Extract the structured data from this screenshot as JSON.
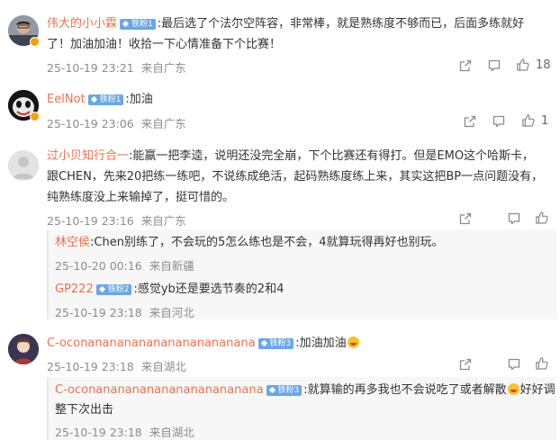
{
  "comments": [
    {
      "username": "伟大的小小霖",
      "badge": "铁粉1",
      "line1": ":最后选了个法尔空阵容，非常棒，就是熟练度不够而已，后面多练就好",
      "line2": "了！加油加油！收拾一下心情准备下个比赛！",
      "time": "25-10-19 23:21",
      "location": "来自广东",
      "likes": "18"
    },
    {
      "username": "EelNot",
      "badge": "铁粉1",
      "line1": ":加油",
      "time": "25-10-19 23:06",
      "location": "来自广东",
      "likes": "1"
    },
    {
      "username": "过小贝知行合一",
      "line1": ":能赢一把李逵，说明还没完全崩，下个比赛还有得打。但是EMO这个哈斯卡，",
      "line2": "跟CHEN，先来20把练一练吧，不说练成绝活，起码熟练度练上来，其实这把BP一点问题没有，",
      "line3": "纯熟练度没上来输掉了，挺可惜的。",
      "time": "25-10-19 23:16",
      "location": "来自广东",
      "likes": "",
      "replies": [
        {
          "username": "林空侯",
          "text": ":Chen别练了，不会玩的5怎么练也是不会，4就算玩得再好也别玩。",
          "time": "25-10-20 00:16",
          "location": "来自新疆"
        },
        {
          "username": "GP222",
          "badge": "铁粉2",
          "text": ":感觉yb还是要选节奏的2和4",
          "time": "25-10-19 23:18",
          "location": "来自河北"
        }
      ]
    },
    {
      "username": "C-oconananananananananananana",
      "badge": "铁粉3",
      "line1": ":加油加油",
      "time": "25-10-19 23:18",
      "location": "来自湖北",
      "likes": "",
      "replies": [
        {
          "username": "C-oconananananananananananana",
          "badge": "铁粉3",
          "text": ":就算输的再多我也不会说吃了或者解散",
          "text_after_emoji": "好好调",
          "text_line2": "整下次出击",
          "time": "25-10-19 23:18",
          "location": "来自湖北"
        }
      ]
    }
  ],
  "icons": {
    "share": "share-icon",
    "comment": "comment-icon",
    "like": "like-icon"
  },
  "colors": {
    "username": "#eb7350",
    "meta": "#8c8c8c",
    "badge": "#6aa7e6",
    "reply_bg": "#f7f7f7"
  }
}
